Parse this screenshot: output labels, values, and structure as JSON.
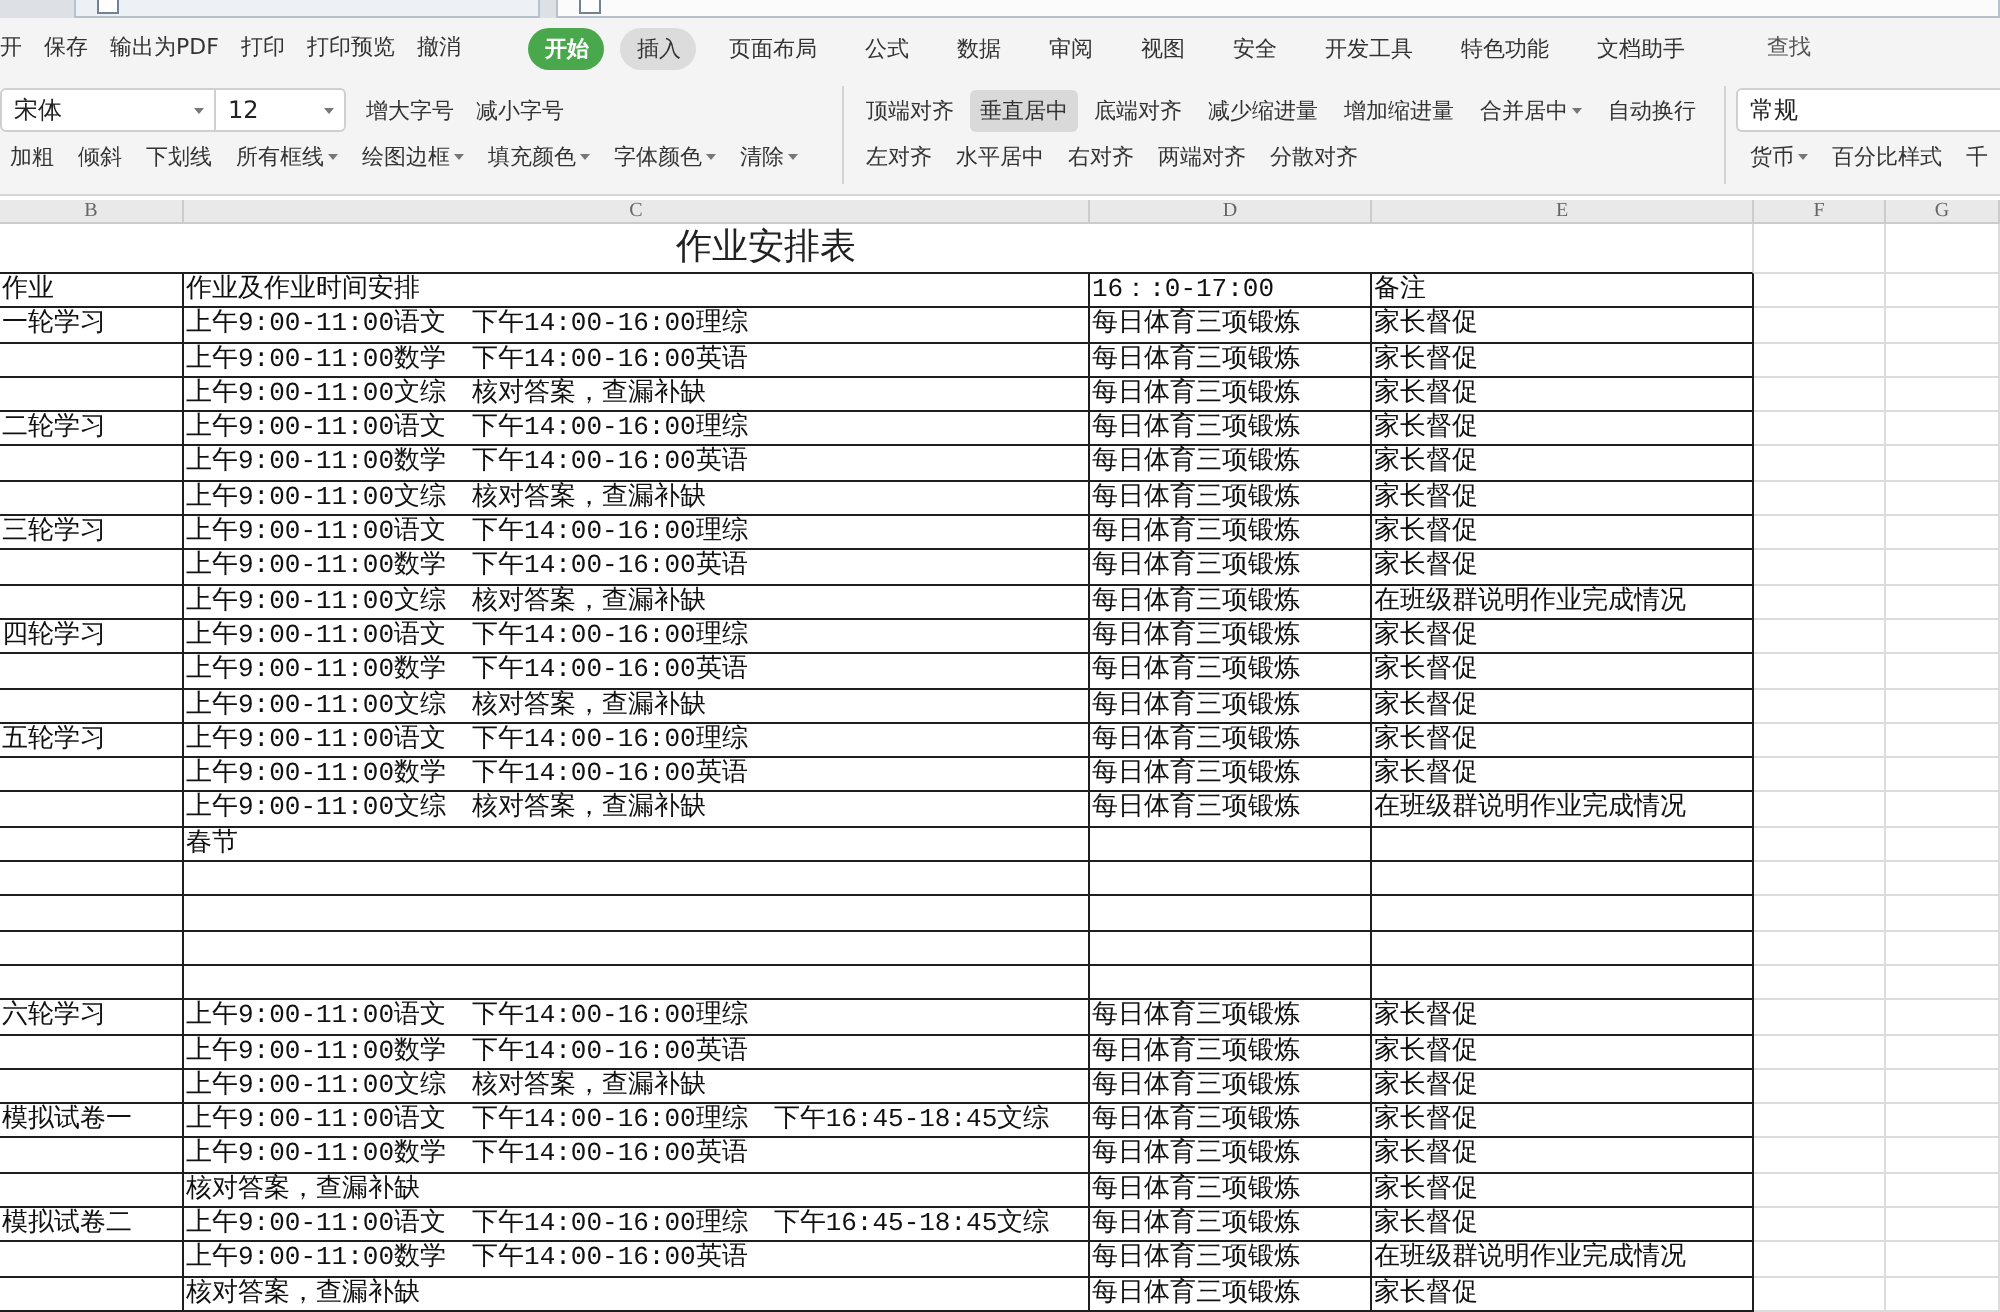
{
  "document_tabs": [
    {
      "selected": false
    },
    {
      "selected": true
    }
  ],
  "menu_bar": {
    "quick_actions": [
      "开",
      "保存",
      "输出为PDF",
      "打印",
      "打印预览",
      "撤消"
    ],
    "tabs": [
      {
        "label": "开始",
        "selected": true,
        "hovered": false
      },
      {
        "label": "插入",
        "selected": false,
        "hovered": true
      },
      {
        "label": "页面布局",
        "selected": false,
        "hovered": false
      },
      {
        "label": "公式",
        "selected": false,
        "hovered": false
      },
      {
        "label": "数据",
        "selected": false,
        "hovered": false
      },
      {
        "label": "审阅",
        "selected": false,
        "hovered": false
      },
      {
        "label": "视图",
        "selected": false,
        "hovered": false
      },
      {
        "label": "安全",
        "selected": false,
        "hovered": false
      },
      {
        "label": "开发工具",
        "selected": false,
        "hovered": false
      },
      {
        "label": "特色功能",
        "selected": false,
        "hovered": false
      },
      {
        "label": "文档助手",
        "selected": false,
        "hovered": false
      }
    ],
    "search": "查找"
  },
  "toolbar": {
    "font": {
      "name": "宋体",
      "size": "12"
    },
    "font_size_buttons": [
      "增大字号",
      "减小字号"
    ],
    "format_buttons": [
      {
        "label": "加粗",
        "dropdown": false
      },
      {
        "label": "倾斜",
        "dropdown": false
      },
      {
        "label": "下划线",
        "dropdown": false
      },
      {
        "label": "所有框线",
        "dropdown": true
      },
      {
        "label": "绘图边框",
        "dropdown": true
      },
      {
        "label": "填充颜色",
        "dropdown": true
      },
      {
        "label": "字体颜色",
        "dropdown": true
      },
      {
        "label": "清除",
        "dropdown": true
      }
    ],
    "align_row_1": [
      {
        "label": "顶端对齐",
        "pressed": false,
        "dropdown": false
      },
      {
        "label": "垂直居中",
        "pressed": true,
        "dropdown": false
      },
      {
        "label": "底端对齐",
        "pressed": false,
        "dropdown": false
      },
      {
        "label": "减少缩进量",
        "pressed": false,
        "dropdown": false
      },
      {
        "label": "增加缩进量",
        "pressed": false,
        "dropdown": false
      },
      {
        "label": "合并居中",
        "pressed": false,
        "dropdown": true
      },
      {
        "label": "自动换行",
        "pressed": false,
        "dropdown": false
      }
    ],
    "align_row_2": [
      "左对齐",
      "水平居中",
      "右对齐",
      "两端对齐",
      "分散对齐"
    ],
    "number_format": "常规",
    "number_buttons": [
      {
        "label": "货币",
        "dropdown": true
      },
      {
        "label": "百分比样式",
        "dropdown": false
      },
      {
        "label": "千",
        "dropdown": false
      }
    ]
  },
  "sheet": {
    "columns": [
      "B",
      "C",
      "D",
      "E",
      "F",
      "G"
    ],
    "title": "作业安排表",
    "header": {
      "column_b": "作业",
      "column_c": "作业及作业时间安排",
      "column_d": "16：:0-17:00",
      "column_e": "备注"
    },
    "rows": [
      {
        "column_b": "一轮学习",
        "column_c": "上午9:00-11:00语文　下午14:00-16:00理综",
        "column_d": "每日体育三项锻炼",
        "column_e": "家长督促"
      },
      {
        "column_c": "上午9:00-11:00数学　下午14:00-16:00英语",
        "column_d": "每日体育三项锻炼",
        "column_e": "家长督促"
      },
      {
        "column_c": "上午9:00-11:00文综　核对答案，查漏补缺",
        "column_d": "每日体育三项锻炼",
        "column_e": "家长督促"
      },
      {
        "column_b": "二轮学习",
        "column_c": "上午9:00-11:00语文　下午14:00-16:00理综",
        "column_d": "每日体育三项锻炼",
        "column_e": "家长督促"
      },
      {
        "column_c": "上午9:00-11:00数学　下午14:00-16:00英语",
        "column_d": "每日体育三项锻炼",
        "column_e": "家长督促"
      },
      {
        "column_c": "上午9:00-11:00文综　核对答案，查漏补缺",
        "column_d": "每日体育三项锻炼",
        "column_e": "家长督促"
      },
      {
        "column_b": "三轮学习",
        "column_c": "上午9:00-11:00语文　下午14:00-16:00理综",
        "column_d": "每日体育三项锻炼",
        "column_e": "家长督促"
      },
      {
        "column_c": "上午9:00-11:00数学　下午14:00-16:00英语",
        "column_d": "每日体育三项锻炼",
        "column_e": "家长督促"
      },
      {
        "column_c": "上午9:00-11:00文综　核对答案，查漏补缺",
        "column_d": "每日体育三项锻炼",
        "column_e": "在班级群说明作业完成情况"
      },
      {
        "column_b": "四轮学习",
        "column_c": "上午9:00-11:00语文　下午14:00-16:00理综",
        "column_d": "每日体育三项锻炼",
        "column_e": "家长督促"
      },
      {
        "column_c": "上午9:00-11:00数学　下午14:00-16:00英语",
        "column_d": "每日体育三项锻炼",
        "column_e": "家长督促"
      },
      {
        "column_c": "上午9:00-11:00文综　核对答案，查漏补缺",
        "column_d": "每日体育三项锻炼",
        "column_e": "家长督促"
      },
      {
        "column_b": "五轮学习",
        "column_c": "上午9:00-11:00语文　下午14:00-16:00理综",
        "column_d": "每日体育三项锻炼",
        "column_e": "家长督促"
      },
      {
        "column_c": "上午9:00-11:00数学　下午14:00-16:00英语",
        "column_d": "每日体育三项锻炼",
        "column_e": "家长督促"
      },
      {
        "column_c": "上午9:00-11:00文综　核对答案，查漏补缺",
        "column_d": "每日体育三项锻炼",
        "column_e": "在班级群说明作业完成情况"
      },
      {
        "column_c": "春节"
      },
      {},
      {},
      {},
      {},
      {
        "column_b": "六轮学习",
        "column_c": "上午9:00-11:00语文　下午14:00-16:00理综",
        "column_d": "每日体育三项锻炼",
        "column_e": "家长督促"
      },
      {
        "column_c": "上午9:00-11:00数学　下午14:00-16:00英语",
        "column_d": "每日体育三项锻炼",
        "column_e": "家长督促"
      },
      {
        "column_c": "上午9:00-11:00文综　核对答案，查漏补缺",
        "column_d": "每日体育三项锻炼",
        "column_e": "家长督促"
      },
      {
        "column_b": "模拟试卷一",
        "column_c": "上午9:00-11:00语文　下午14:00-16:00理综　下午16:45-18:45文综",
        "column_d": "每日体育三项锻炼",
        "column_e": "家长督促"
      },
      {
        "column_c": "上午9:00-11:00数学　下午14:00-16:00英语",
        "column_d": "每日体育三项锻炼",
        "column_e": "家长督促"
      },
      {
        "column_c": "核对答案，查漏补缺",
        "column_d": "每日体育三项锻炼",
        "column_e": "家长督促"
      },
      {
        "column_b": "模拟试卷二",
        "column_c": "上午9:00-11:00语文　下午14:00-16:00理综　下午16:45-18:45文综",
        "column_d": "每日体育三项锻炼",
        "column_e": "家长督促"
      },
      {
        "column_c": "上午9:00-11:00数学　下午14:00-16:00英语",
        "column_d": "每日体育三项锻炼",
        "column_e": "在班级群说明作业完成情况"
      },
      {
        "column_c": "核对答案，查漏补缺",
        "column_d": "每日体育三项锻炼",
        "column_e": "家长督促"
      }
    ]
  }
}
